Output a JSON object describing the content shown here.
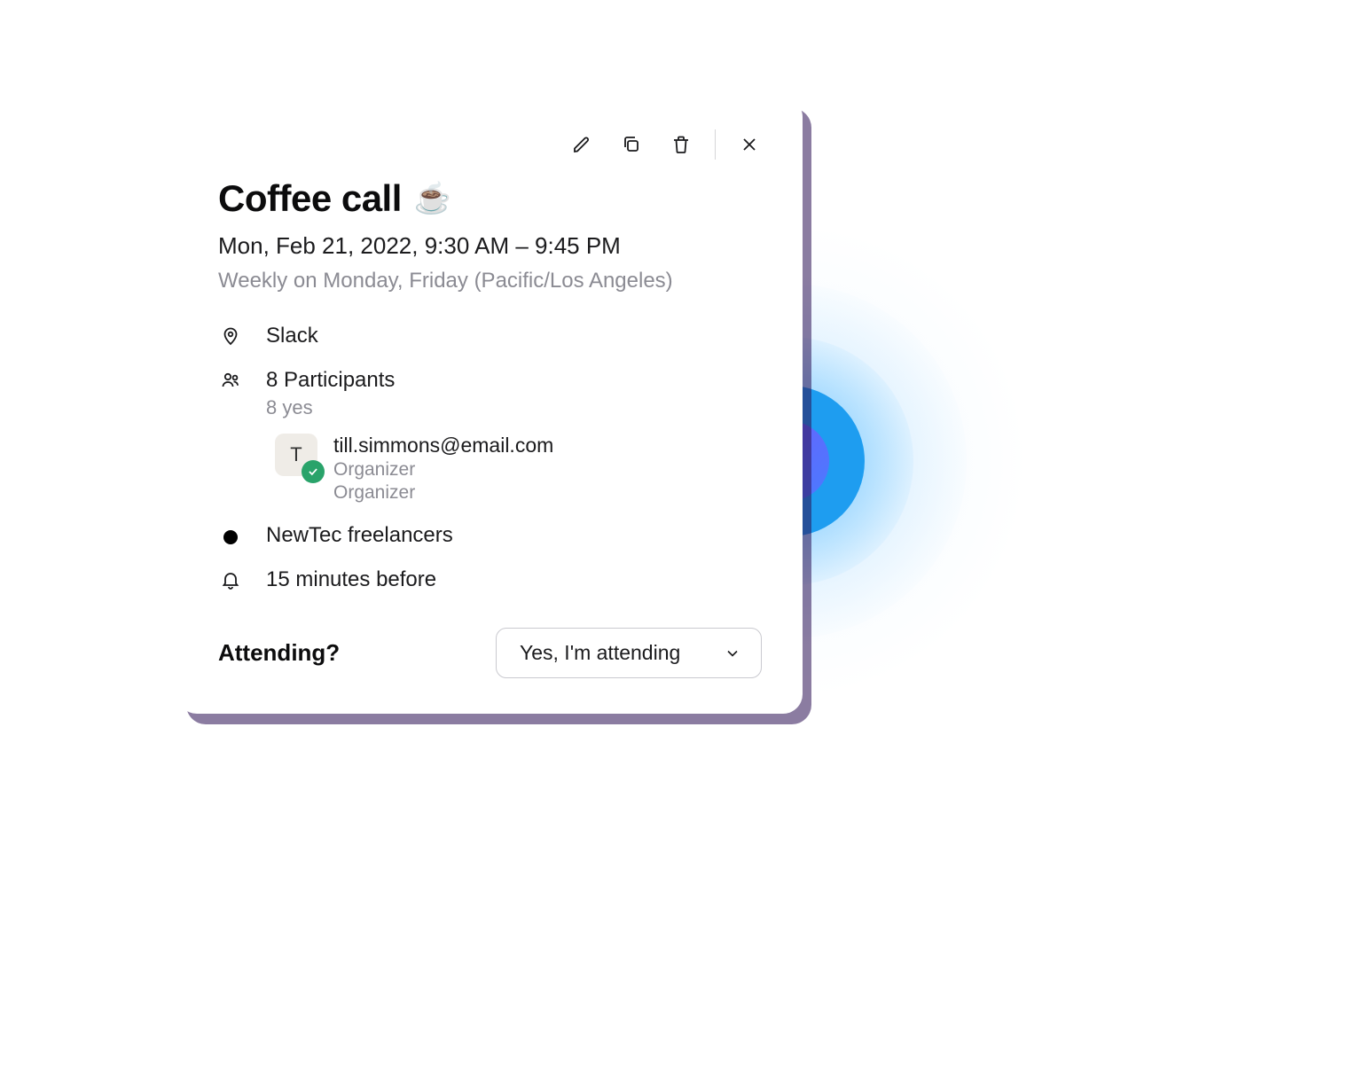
{
  "event": {
    "title": "Coffee call",
    "emoji": "☕",
    "datetime": "Mon, Feb 21, 2022, 9:30 AM – 9:45 PM",
    "recurrence": "Weekly on Monday, Friday (Pacific/Los Angeles)"
  },
  "location": "Slack",
  "participants": {
    "count_text": "8 Participants",
    "yes_text": "8 yes",
    "organizer": {
      "initial": "T",
      "email": "till.simmons@email.com",
      "role1": "Organizer",
      "role2": "Organizer"
    }
  },
  "calendar": "NewTec freelancers",
  "reminder": "15 minutes before",
  "attending": {
    "label": "Attending?",
    "selected": "Yes, I'm attending"
  }
}
